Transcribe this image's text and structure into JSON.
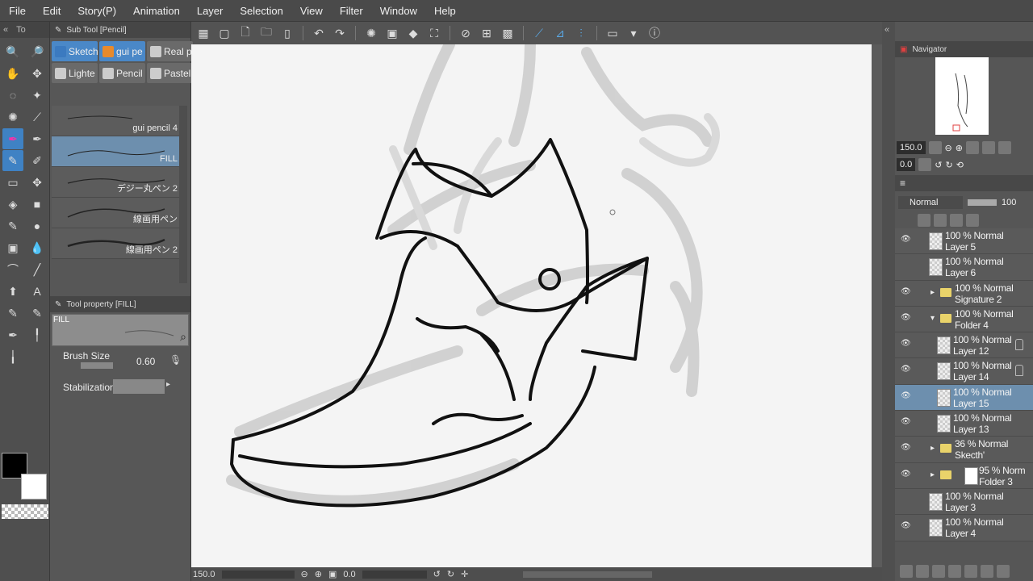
{
  "menu": [
    "File",
    "Edit",
    "Story(P)",
    "Animation",
    "Layer",
    "Selection",
    "View",
    "Filter",
    "Window",
    "Help"
  ],
  "left_panel": {
    "tool_tab_label": "To",
    "tools": [
      "zoom-icon",
      "zoom-out-icon",
      "hand-icon",
      "rotate-icon",
      "lasso-icon",
      "magic-wand-icon",
      "sparkle-icon",
      "eyedropper-icon",
      "pen-icon",
      "pen-alt-icon",
      "pencil-icon",
      "eraser-icon",
      "eraser-alt-icon",
      "blend-icon",
      "fill-bucket-icon",
      "gradient-icon",
      "brush-icon",
      "ink-icon",
      "ruler-icon",
      "text-icon",
      "curve-icon",
      "line-icon",
      "arrow-icon",
      "balloon-icon",
      "brush-alt-icon",
      "brush-red-icon",
      "pin-icon",
      "pin-alt-icon",
      "needle-icon"
    ]
  },
  "sub_tool": {
    "title": "Sub Tool [Pencil]",
    "tabs": [
      {
        "label": "Sketch",
        "active": true
      },
      {
        "label": "gui pe",
        "active": true
      },
      {
        "label": "Real p",
        "active": false
      },
      {
        "label": "Lighte",
        "active": false
      },
      {
        "label": "Pencil",
        "active": false
      },
      {
        "label": "Pastel",
        "active": false
      }
    ],
    "brushes": [
      {
        "name": "gui pencil 4",
        "selected": false
      },
      {
        "name": "FILL",
        "selected": true
      },
      {
        "name": "デジー丸ペン 2",
        "selected": false
      },
      {
        "name": "線画用ペン",
        "selected": false
      },
      {
        "name": "線画用ペン 2",
        "selected": false
      }
    ]
  },
  "tool_property": {
    "title": "Tool property [FILL]",
    "preview_label": "FILL",
    "brush_size_label": "Brush Size",
    "brush_size_value": "0.60",
    "stabilization_label": "Stabilization"
  },
  "status": {
    "zoom": "150.0",
    "rotation": "0.0"
  },
  "navigator": {
    "title": "Navigator",
    "zoom": "150.0",
    "rotation": "0.0"
  },
  "layers_panel": {
    "blend_mode": "Normal",
    "opacity": "100",
    "layers": [
      {
        "mode": "100 % Normal",
        "name": "Layer 5",
        "type": "layer",
        "visible": true,
        "selected": false,
        "indent": 0,
        "lock": false
      },
      {
        "mode": "100 % Normal",
        "name": "Layer 6",
        "type": "layer",
        "visible": false,
        "selected": false,
        "indent": 0,
        "lock": false
      },
      {
        "mode": "100 % Normal",
        "name": "Signature 2",
        "type": "folder",
        "visible": true,
        "selected": false,
        "indent": 0,
        "lock": false,
        "expanded": false
      },
      {
        "mode": "100 % Normal",
        "name": "Folder 4",
        "type": "folder",
        "visible": true,
        "selected": false,
        "indent": 0,
        "lock": false,
        "expanded": true
      },
      {
        "mode": "100 % Normal",
        "name": "Layer 12",
        "type": "layer",
        "visible": true,
        "selected": false,
        "indent": 1,
        "lock": true
      },
      {
        "mode": "100 % Normal",
        "name": "Layer 14",
        "type": "layer",
        "visible": true,
        "selected": false,
        "indent": 1,
        "lock": true
      },
      {
        "mode": "100 % Normal",
        "name": "Layer 15",
        "type": "layer",
        "visible": true,
        "selected": true,
        "indent": 1,
        "lock": false
      },
      {
        "mode": "100 % Normal",
        "name": "Layer 13",
        "type": "layer",
        "visible": true,
        "selected": false,
        "indent": 1,
        "lock": false
      },
      {
        "mode": "36 % Normal",
        "name": "Skecth'",
        "type": "folder",
        "visible": true,
        "selected": false,
        "indent": 0,
        "lock": false,
        "expanded": false
      },
      {
        "mode": "95 % Norm",
        "name": "Folder 3",
        "type": "folder",
        "visible": true,
        "selected": false,
        "indent": 0,
        "lock": false,
        "expanded": false
      },
      {
        "mode": "100 % Normal",
        "name": "Layer 3",
        "type": "layer",
        "visible": false,
        "selected": false,
        "indent": 0,
        "lock": false
      },
      {
        "mode": "100 % Normal",
        "name": "Layer 4",
        "type": "layer",
        "visible": true,
        "selected": false,
        "indent": 0,
        "lock": false
      }
    ]
  },
  "colors": {
    "main": "#000000",
    "sub": "#ffffff",
    "accent": "#4a88c8",
    "selection": "#6d8fae"
  }
}
